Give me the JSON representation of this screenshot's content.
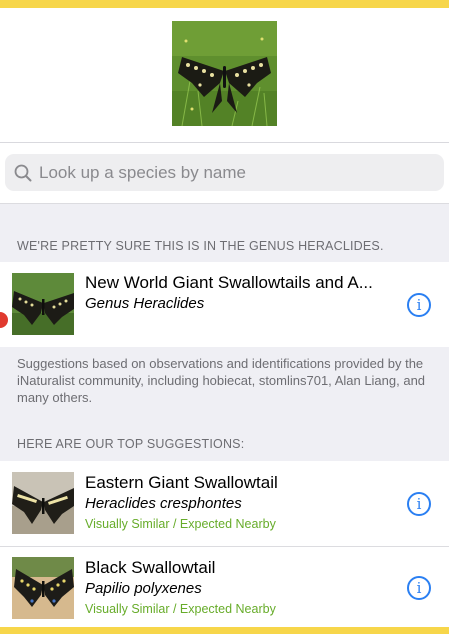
{
  "search": {
    "placeholder": "Look up a species by name"
  },
  "genus_section": {
    "header": "WE'RE PRETTY SURE THIS IS IN THE GENUS HERACLIDES.",
    "item": {
      "common_name": "New World Giant Swallowtails and A...",
      "scientific_name": "Genus Heraclides",
      "info_glyph": "i"
    },
    "footer": "Suggestions based on observations and identifications provided by the iNaturalist community, including hobiecat, stomlins701, Alan Liang, and many others."
  },
  "suggestions_section": {
    "header": "HERE ARE OUR TOP SUGGESTIONS:",
    "items": [
      {
        "common_name": "Eastern Giant Swallowtail",
        "scientific_name": "Heraclides cresphontes",
        "tag": "Visually Similar / Expected Nearby",
        "info_glyph": "i"
      },
      {
        "common_name": "Black Swallowtail",
        "scientific_name": "Papilio polyxenes",
        "tag": "Visually Similar / Expected Nearby",
        "info_glyph": "i"
      }
    ]
  },
  "colors": {
    "frame": "#f7d64a",
    "accent_blue": "#2a7ff2",
    "tag_green": "#67ac2a",
    "section_gray": "#efeff4"
  }
}
